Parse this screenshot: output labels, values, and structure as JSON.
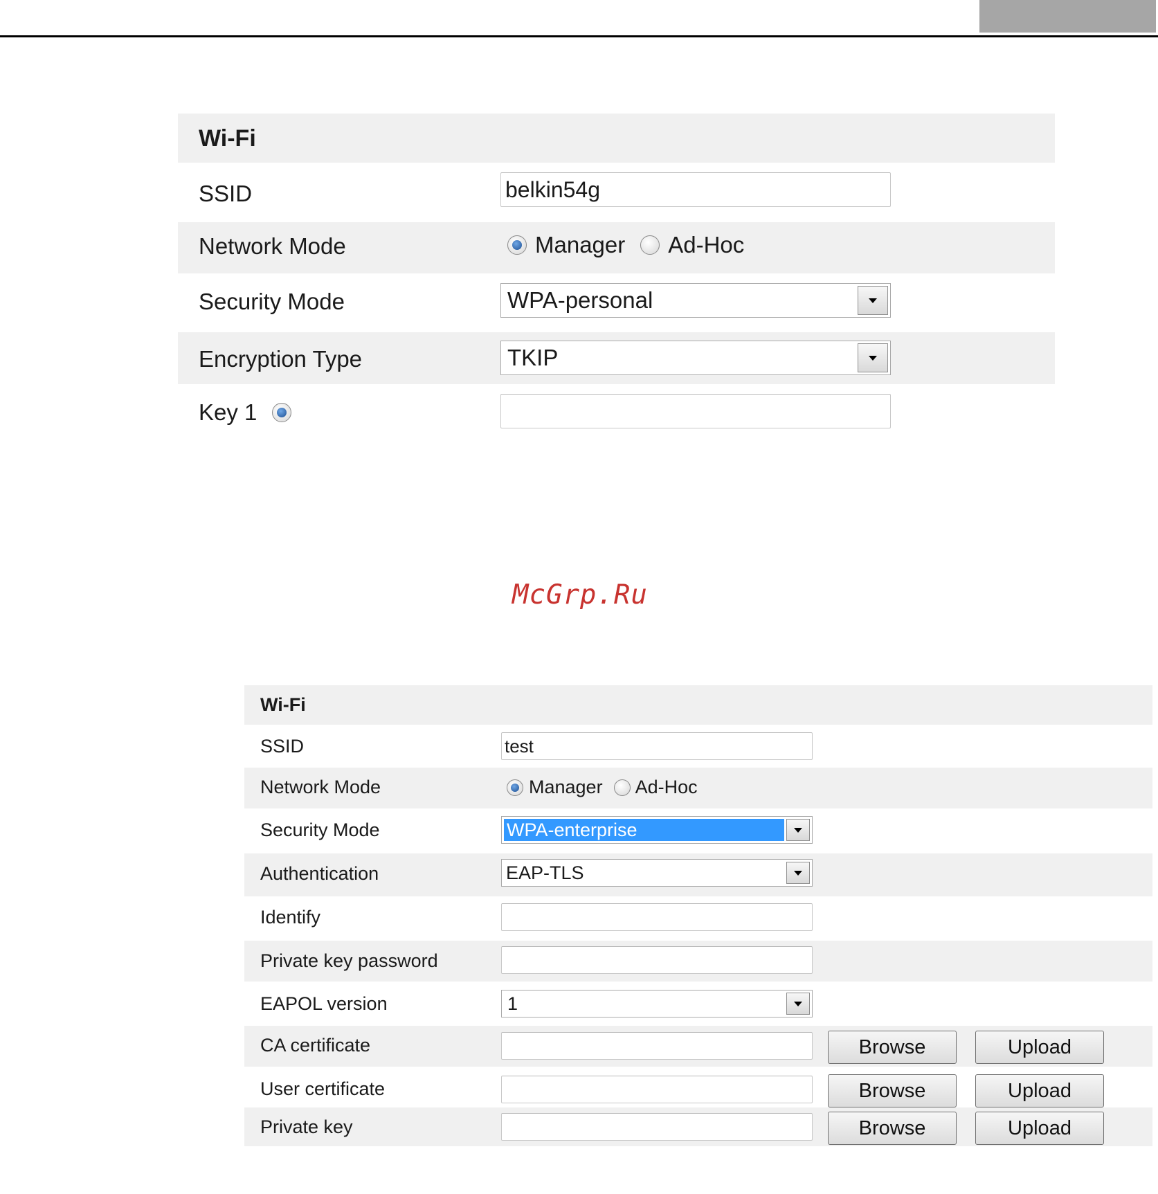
{
  "watermark": "McGrp.Ru",
  "panel1": {
    "title": "Wi-Fi",
    "ssid_label": "SSID",
    "ssid_value": "belkin54g",
    "network_mode_label": "Network Mode",
    "network_mode_options": [
      "Manager",
      "Ad-Hoc"
    ],
    "network_mode_selected": "Manager",
    "security_mode_label": "Security Mode",
    "security_mode_value": "WPA-personal",
    "encryption_type_label": "Encryption Type",
    "encryption_type_value": "TKIP",
    "key1_label": "Key 1",
    "key1_selected": true,
    "key1_value": ""
  },
  "panel2": {
    "title": "Wi-Fi",
    "ssid_label": "SSID",
    "ssid_value": "test",
    "network_mode_label": "Network Mode",
    "network_mode_options": [
      "Manager",
      "Ad-Hoc"
    ],
    "network_mode_selected": "Manager",
    "security_mode_label": "Security Mode",
    "security_mode_value": "WPA-enterprise",
    "authentication_label": "Authentication",
    "authentication_value": "EAP-TLS",
    "identify_label": "Identify",
    "identify_value": "",
    "private_key_password_label": "Private key password",
    "private_key_password_value": "",
    "eapol_version_label": "EAPOL version",
    "eapol_version_value": "1",
    "ca_certificate_label": "CA certificate",
    "user_certificate_label": "User certificate",
    "private_key_label": "Private key",
    "browse_label": "Browse",
    "upload_label": "Upload"
  }
}
